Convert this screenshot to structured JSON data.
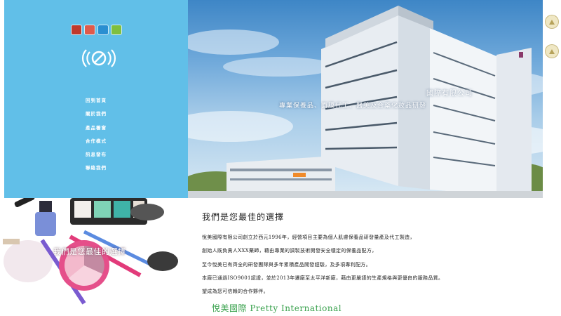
{
  "sidebar": {
    "top_icons": [
      {
        "name": "home-icon",
        "color": "#c0392b"
      },
      {
        "name": "mail-icon",
        "color": "#e05a4b"
      },
      {
        "name": "skype-icon",
        "color": "#2a8fd1"
      },
      {
        "name": "chat-icon",
        "color": "#7fbf3f"
      }
    ],
    "logo_icon": "broadcast-logo-icon",
    "nav": [
      "回到首頁",
      "關於我們",
      "產品櫥窗",
      "合作模式",
      "訊息發布",
      "聯絡我們"
    ]
  },
  "hero": {
    "title": "國際有限公司",
    "subtitle": "專業保養品、面膜代工、醫美及合藥化妝品研發"
  },
  "side_icons": [
    "up-arrow-icon",
    "up-arrow-icon"
  ],
  "cosmetics_caption": "我們是您最佳的選擇",
  "content": {
    "heading": "我們是您最佳的選擇",
    "paragraphs": [
      "悅美國際有限公司創立於西元1996年，經營項目主要為個人肌膚保養品研發量產及代工製造，",
      "創始人既負責人XXX藥師，藉由專業的調製技術開發安全穩定的保養品配方，",
      "至今悅美已有齊全的研發團隊與多年累積產品開發經驗，及多項專利配方。",
      "本廠已通過ISO9001認證，並於2013年遷廠至太平洋新廠，藉由更嚴謹的生產規格與更優良的服務品質。",
      "望成為您可信賴的合作夥伴。"
    ],
    "brand": "悅美國際 Pretty International"
  },
  "colors": {
    "sidebar": "#61bfe8",
    "brand_green": "#3aa24e"
  }
}
